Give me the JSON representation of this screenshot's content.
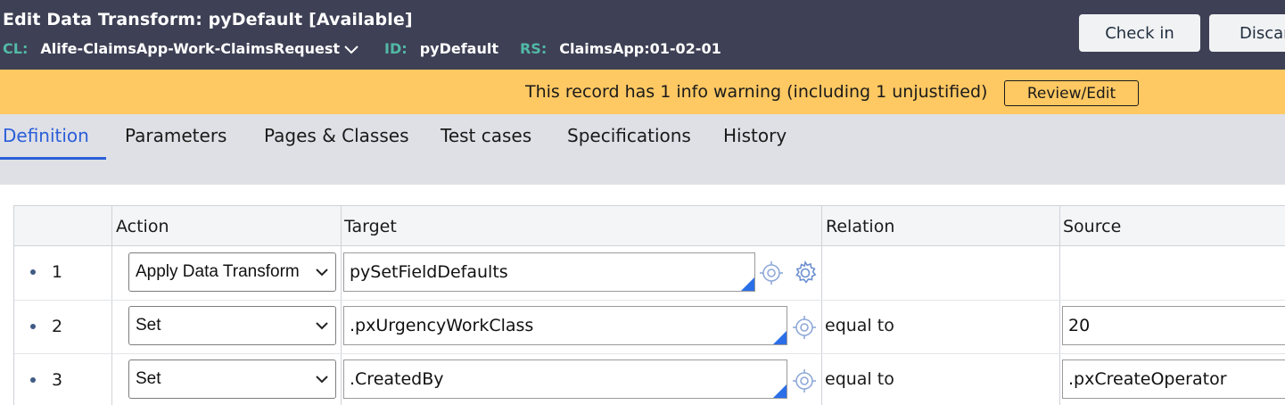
{
  "header": {
    "title": "Edit  Data Transform: pyDefault [Available]",
    "cl_label": "CL:",
    "cl_value": "Alife-ClaimsApp-Work-ClaimsRequest",
    "id_label": "ID:",
    "id_value": "pyDefault",
    "rs_label": "RS:",
    "rs_value": "ClaimsApp:01-02-01",
    "checkin_label": "Check in",
    "discard_label": "Discar"
  },
  "warning": {
    "text": "This record has 1 info warning (including 1 unjustified)",
    "button_label": "Review/Edit"
  },
  "tabs": [
    {
      "label": "Definition",
      "active": true
    },
    {
      "label": "Parameters"
    },
    {
      "label": "Pages & Classes"
    },
    {
      "label": "Test cases"
    },
    {
      "label": "Specifications"
    },
    {
      "label": "History"
    }
  ],
  "grid": {
    "columns": [
      "Action",
      "Target",
      "Relation",
      "Source"
    ],
    "rows": [
      {
        "num": "1",
        "action": "Apply Data Transform",
        "target": "pySetFieldDefaults",
        "relation": "",
        "source": ""
      },
      {
        "num": "2",
        "action": "Set",
        "target": ".pxUrgencyWorkClass",
        "relation": "equal to",
        "source": "20"
      },
      {
        "num": "3",
        "action": "Set",
        "target": ".CreatedBy",
        "relation": "equal to",
        "source": ".pxCreateOperator"
      }
    ]
  },
  "colors": {
    "header_bg": "#3e4055",
    "meta_label": "#52b9a6",
    "warning_bg": "#fec862",
    "tab_active": "#2b5ed8",
    "tabs_bg": "#dfe0e6",
    "corner_marker": "#2b6fe8"
  }
}
